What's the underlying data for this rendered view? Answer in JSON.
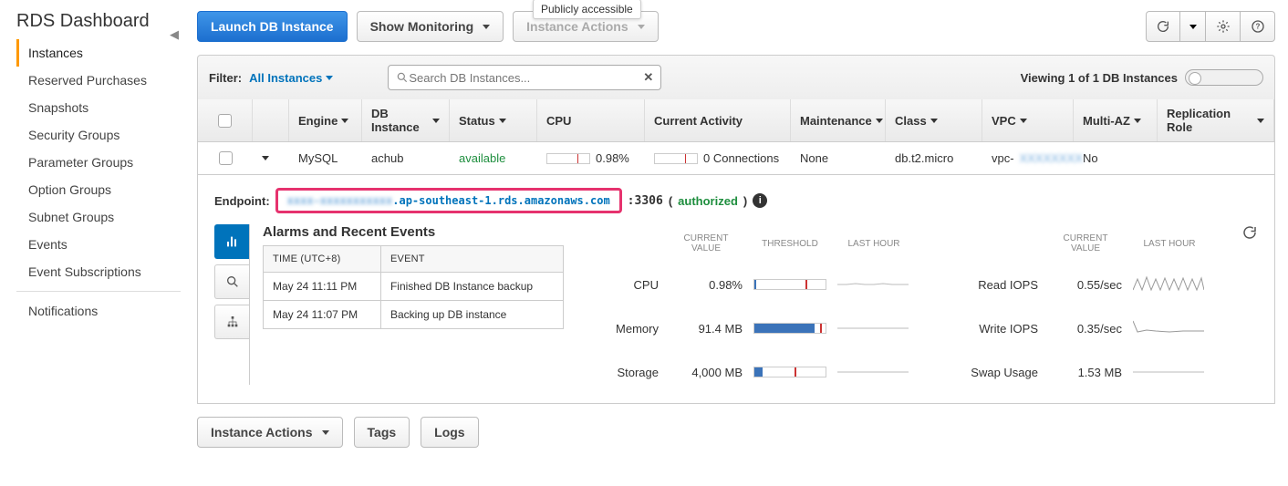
{
  "sidebar": {
    "title": "RDS Dashboard",
    "items": [
      {
        "label": "Instances",
        "active": true
      },
      {
        "label": "Reserved Purchases"
      },
      {
        "label": "Snapshots"
      },
      {
        "label": "Security Groups"
      },
      {
        "label": "Parameter Groups"
      },
      {
        "label": "Option Groups"
      },
      {
        "label": "Subnet Groups"
      },
      {
        "label": "Events"
      },
      {
        "label": "Event Subscriptions"
      }
    ],
    "extra": [
      {
        "label": "Notifications"
      }
    ]
  },
  "toolbar": {
    "launch": "Launch DB Instance",
    "show_monitoring": "Show Monitoring",
    "instance_actions": "Instance Actions"
  },
  "filter": {
    "label": "Filter:",
    "selection": "All Instances",
    "search_placeholder": "Search DB Instances...",
    "viewing": "Viewing 1 of 1 DB Instances"
  },
  "columns": {
    "engine": "Engine",
    "db_instance": "DB Instance",
    "status": "Status",
    "cpu": "CPU",
    "current_activity": "Current Activity",
    "maintenance": "Maintenance",
    "class": "Class",
    "vpc": "VPC",
    "multi_az": "Multi-AZ",
    "replication_role": "Replication Role"
  },
  "row": {
    "engine": "MySQL",
    "db_instance": "achub",
    "status": "available",
    "cpu_pct": "0.98%",
    "connections": "0 Connections",
    "maintenance": "None",
    "class": "db.t2.micro",
    "vpc": "vpc-",
    "multi_az": "No"
  },
  "endpoint": {
    "label": "Endpoint:",
    "host": "********.ap-southeast-1.rds.amazonaws.com",
    "port": ":3306",
    "authorized": "authorized",
    "tooltip": "Publicly accessible"
  },
  "events": {
    "title": "Alarms and Recent Events",
    "th_time": "TIME (UTC+8)",
    "th_event": "EVENT",
    "rows": [
      {
        "time": "May 24 11:11 PM",
        "event": "Finished DB Instance backup"
      },
      {
        "time": "May 24 11:07 PM",
        "event": "Backing up DB instance"
      }
    ]
  },
  "metrics": {
    "head_current": "CURRENT VALUE",
    "head_threshold": "THRESHOLD",
    "head_lasthour": "LAST HOUR",
    "left": [
      {
        "name": "CPU",
        "value": "0.98%",
        "fill": 3,
        "red": 72
      },
      {
        "name": "Memory",
        "value": "91.4 MB",
        "fill": 85,
        "red": 92
      },
      {
        "name": "Storage",
        "value": "4,000 MB",
        "fill": 12,
        "red": 56
      }
    ],
    "right": [
      {
        "name": "Read IOPS",
        "value": "0.55/sec"
      },
      {
        "name": "Write IOPS",
        "value": "0.35/sec"
      },
      {
        "name": "Swap Usage",
        "value": "1.53 MB"
      }
    ]
  },
  "bottom": {
    "instance_actions": "Instance Actions",
    "tags": "Tags",
    "logs": "Logs"
  }
}
